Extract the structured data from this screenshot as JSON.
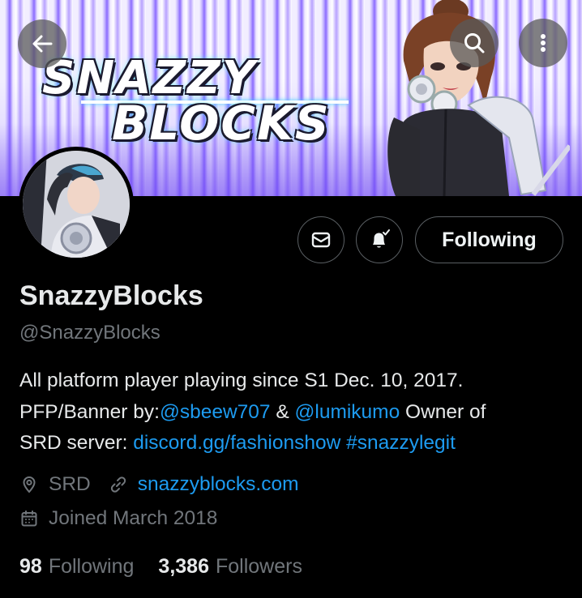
{
  "banner": {
    "logo_line1": "SNAZZY",
    "logo_line2": "BLOCKS"
  },
  "header": {
    "back_icon": "arrow-left-icon",
    "search_icon": "search-icon",
    "more_icon": "more-vertical-icon"
  },
  "actions": {
    "message_icon": "envelope-icon",
    "notify_icon": "bell-check-icon",
    "following_label": "Following"
  },
  "profile": {
    "display_name": "SnazzyBlocks",
    "handle": "@SnazzyBlocks",
    "bio": {
      "line1": "All platform player playing since S1 Dec. 10, 2017.",
      "line2_prefix": "PFP/Banner by:",
      "mention1": "@sbeew707",
      "amp": " & ",
      "mention2": "@lumikumo",
      "line2_suffix": " Owner of",
      "line3_prefix": "SRD server: ",
      "link": "discord.gg/fashionshow",
      "space": " ",
      "hashtag": "#snazzylegit"
    },
    "location": "SRD",
    "website": "snazzyblocks.com",
    "joined": "Joined March 2018"
  },
  "stats": {
    "following_count": "98",
    "following_label": "Following",
    "followers_count": "3,386",
    "followers_label": "Followers"
  },
  "colors": {
    "background": "#000000",
    "text": "#e7e9ea",
    "muted": "#71767b",
    "link": "#1d9bf0",
    "border": "#5a5f63"
  }
}
